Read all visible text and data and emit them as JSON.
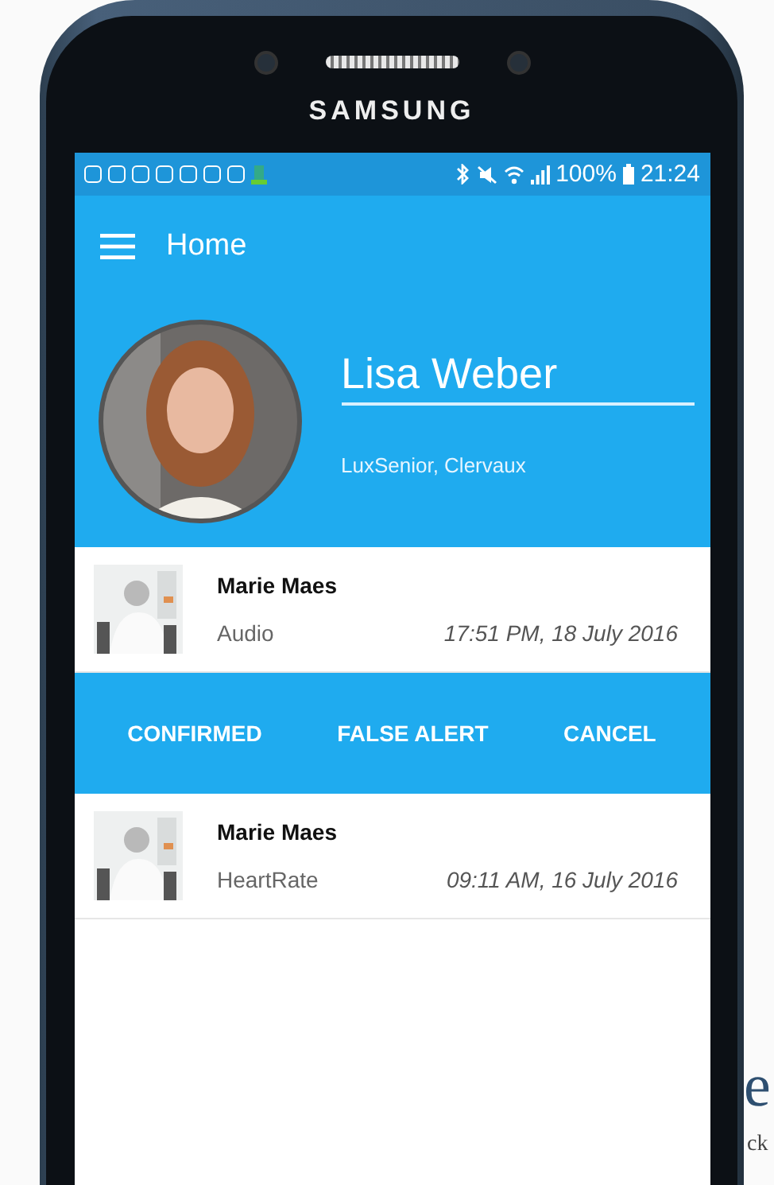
{
  "device": {
    "brand": "SAMSUNG"
  },
  "status_bar": {
    "battery": "100%",
    "time": "21:24"
  },
  "app_bar": {
    "title": "Home"
  },
  "profile": {
    "name": "Lisa Weber",
    "location": "LuxSenior, Clervaux"
  },
  "alerts": [
    {
      "kind": "alert",
      "name": "Marie Maes",
      "type": "Audio",
      "time": "17:51 PM, 18 July 2016",
      "expanded": true
    },
    {
      "kind": "alert",
      "name": "Marie Maes",
      "type": "HeartRate",
      "time": "09:11 AM, 16 July 2016",
      "expanded": false
    }
  ],
  "actions": [
    "CONFIRMED",
    "FALSE ALERT",
    "CANCEL"
  ],
  "background_text": [
    {
      "text": "e"
    },
    {
      "text": "ck"
    }
  ]
}
